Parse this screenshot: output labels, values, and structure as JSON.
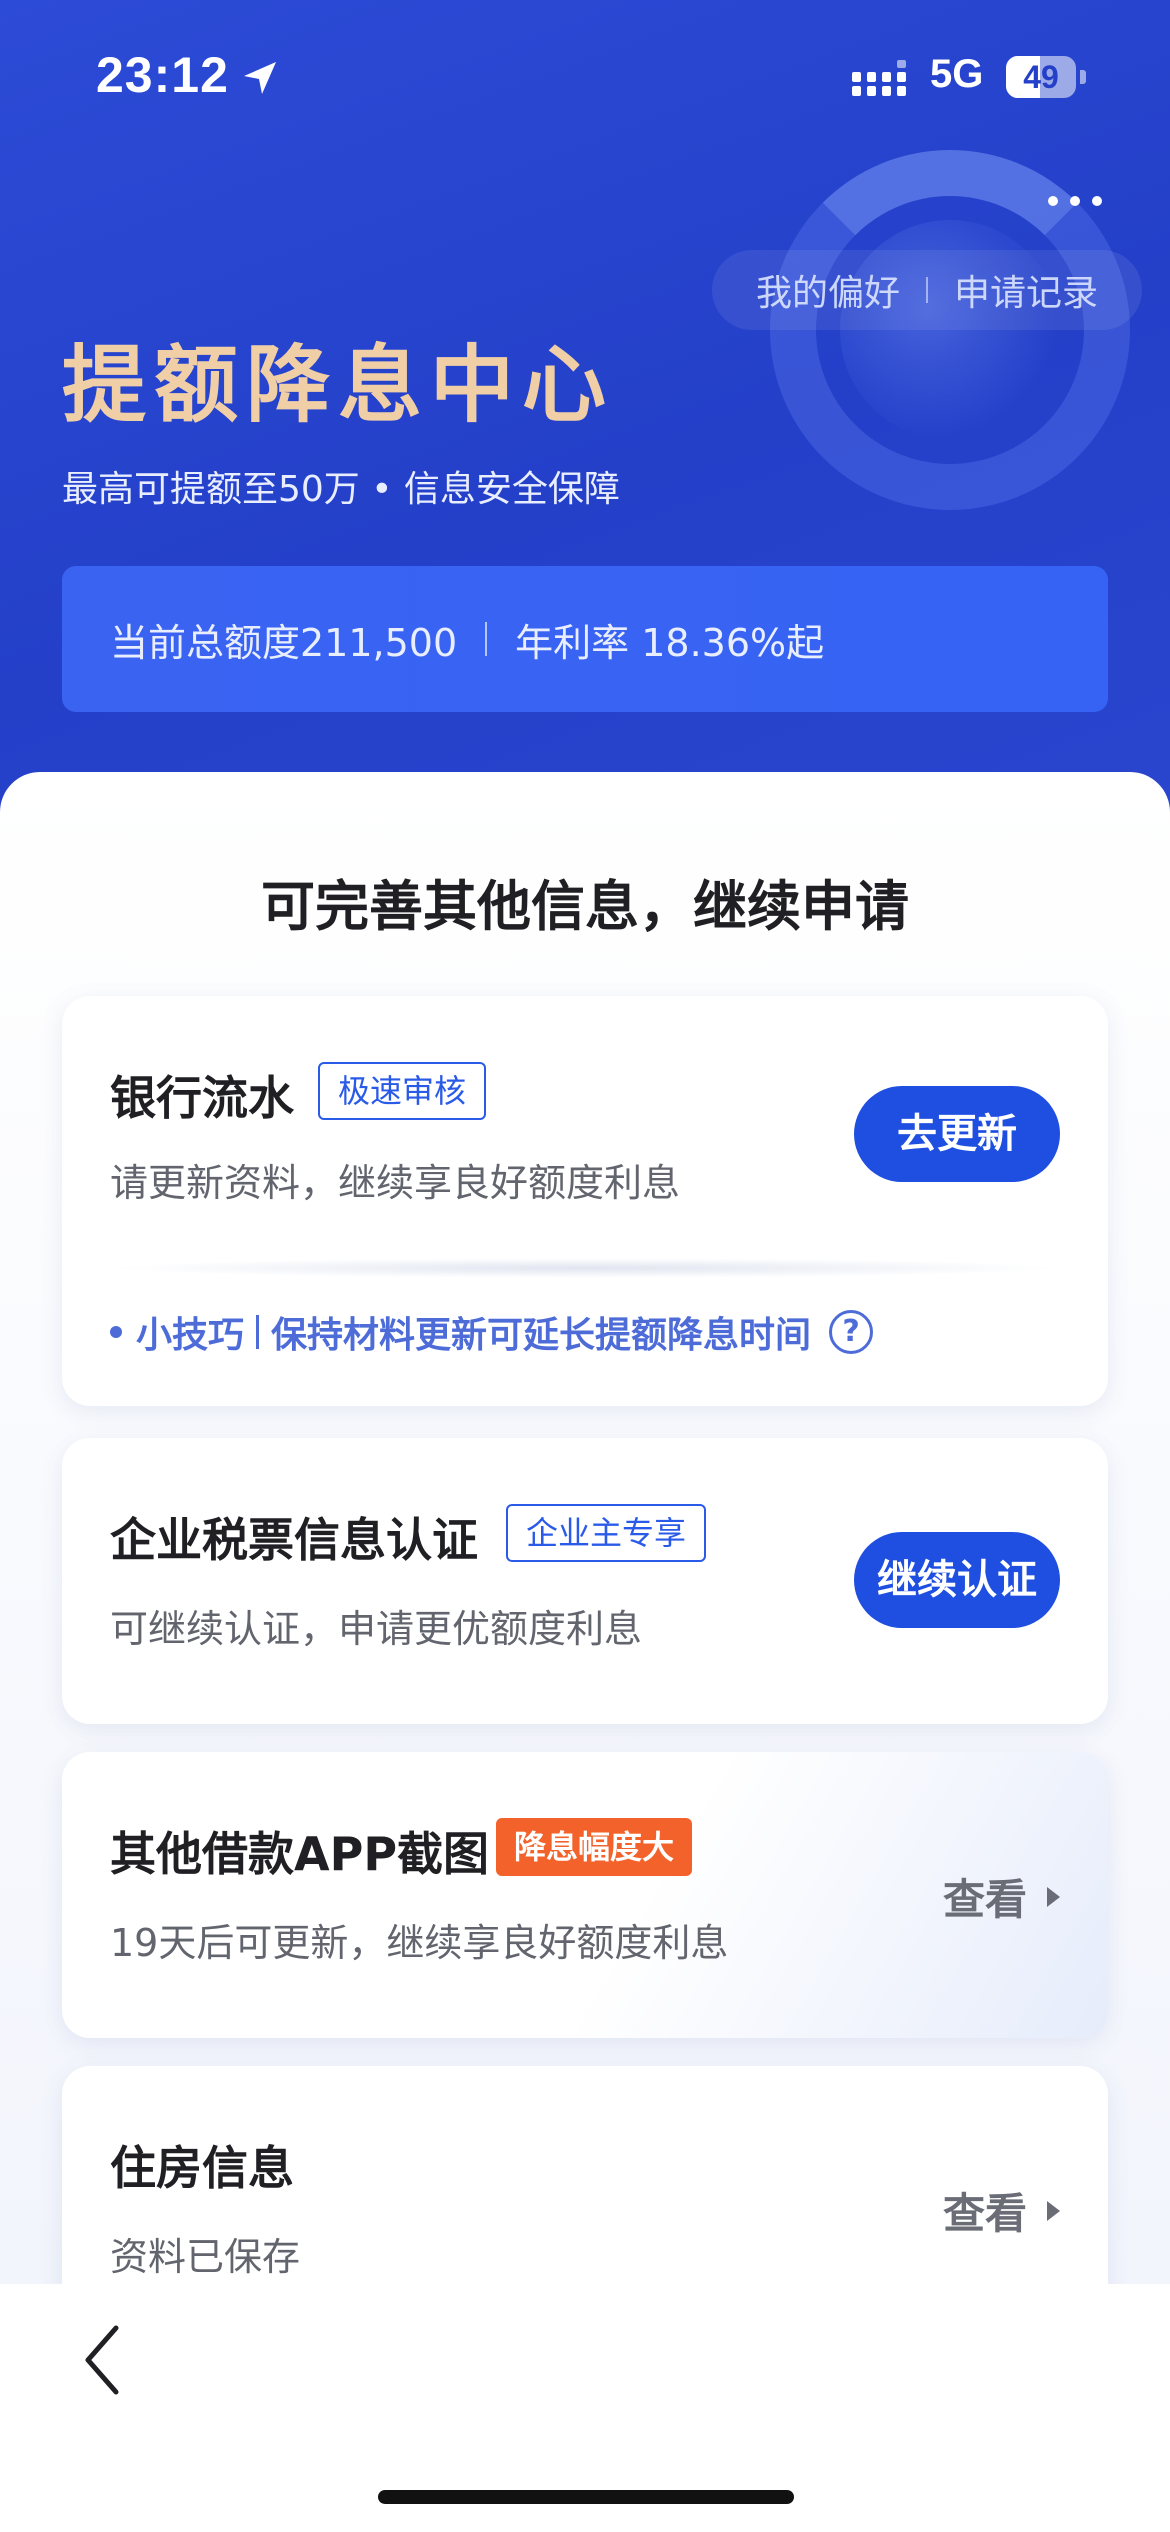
{
  "status_bar": {
    "time": "23:12",
    "network": "5G",
    "battery": "49",
    "battery_level": 0.49
  },
  "header": {
    "links": [
      "我的偏好",
      "申请记录"
    ],
    "title": "提额降息中心",
    "subtitle": "最高可提额至50万 • 信息安全保障",
    "quota_text": "当前总额度211,500",
    "rate_text": "年利率 18.36%起"
  },
  "main": {
    "section_title": "可完善其他信息，继续申请",
    "cards": [
      {
        "title": "银行流水",
        "tag": "极速审核",
        "desc": "请更新资料，继续享良好额度利息",
        "action": "去更新",
        "tip_label": "小技巧",
        "tip_text": "保持材料更新可延长提额降息时间",
        "help": "?"
      },
      {
        "title": "企业税票信息认证",
        "tag": "企业主专享",
        "desc": "可继续认证，申请更优额度利息",
        "action": "继续认证"
      },
      {
        "title": "其他借款APP截图",
        "tag": "降息幅度大",
        "desc": "19天后可更新，继续享良好额度利息",
        "action": "查看"
      },
      {
        "title": "住房信息",
        "desc": "资料已保存",
        "action": "查看"
      }
    ]
  },
  "colors": {
    "header_bg": "#2440c9",
    "title_gold": "#f0cfa6",
    "primary": "#1e4fe0",
    "tag_orange": "#f2622a"
  },
  "icons": [
    "location-arrow-icon",
    "signal-bars-icon",
    "more-dots-icon",
    "help-circle-icon",
    "chevron-left-icon",
    "triangle-right-icon"
  ]
}
